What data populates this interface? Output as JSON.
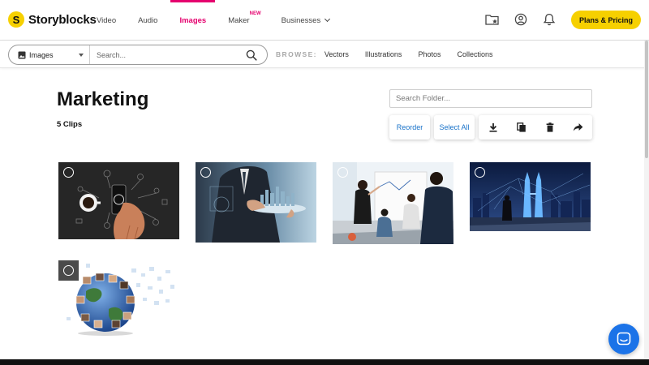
{
  "brand": {
    "name": "Storyblocks",
    "mark": "S",
    "accent": "#e5006e",
    "yellow": "#f6d000"
  },
  "nav": {
    "links": [
      {
        "label": "Video"
      },
      {
        "label": "Audio"
      },
      {
        "label": "Images",
        "active": true
      },
      {
        "label": "Maker",
        "badge": "NEW"
      },
      {
        "label": "Businesses",
        "has_dropdown": true
      }
    ],
    "icons": [
      "folder-star-icon",
      "account-icon",
      "bell-icon"
    ],
    "plans_label": "Plans & Pricing"
  },
  "search": {
    "type_selected": "Images",
    "placeholder": "Search...",
    "browse_label": "BROWSE:",
    "browse_links": [
      "Vectors",
      "Illustrations",
      "Photos",
      "Collections"
    ]
  },
  "folder": {
    "title": "Marketing",
    "count": "5 Clips",
    "search_placeholder": "Search Folder...",
    "reorder_label": "Reorder",
    "select_all_label": "Select All",
    "action_icons": [
      "download-icon",
      "copy-icon",
      "trash-icon",
      "share-icon"
    ]
  },
  "clips": [
    {
      "subject": "Phone with marketing icons"
    },
    {
      "subject": "Businessman with digital city"
    },
    {
      "subject": "Team meeting at whiteboard"
    },
    {
      "subject": "Businessman viewing city skyline network"
    },
    {
      "subject": "Globe with people photos"
    }
  ],
  "colors": {
    "link_blue": "#1a73c9",
    "chat_blue": "#1b73e8"
  }
}
